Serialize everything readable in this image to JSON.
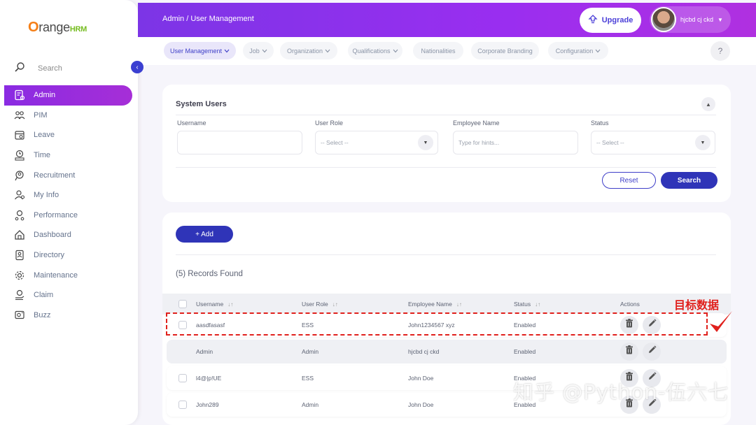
{
  "brand": {
    "logo_o": "O",
    "logo_text": "range",
    "logo_hrm": "HRM"
  },
  "sidebar": {
    "search_label": "Search",
    "items": [
      {
        "label": "Admin",
        "icon": "admin-icon",
        "active": true
      },
      {
        "label": "PIM",
        "icon": "pim-icon"
      },
      {
        "label": "Leave",
        "icon": "leave-icon"
      },
      {
        "label": "Time",
        "icon": "time-icon"
      },
      {
        "label": "Recruitment",
        "icon": "recruitment-icon"
      },
      {
        "label": "My Info",
        "icon": "my-info-icon"
      },
      {
        "label": "Performance",
        "icon": "performance-icon"
      },
      {
        "label": "Dashboard",
        "icon": "dashboard-icon"
      },
      {
        "label": "Directory",
        "icon": "directory-icon"
      },
      {
        "label": "Maintenance",
        "icon": "maintenance-icon"
      },
      {
        "label": "Claim",
        "icon": "claim-icon"
      },
      {
        "label": "Buzz",
        "icon": "buzz-icon"
      }
    ]
  },
  "header": {
    "breadcrumb": "Admin / User Management",
    "upgrade_label": "Upgrade",
    "user_name": "hjcbd cj ckd"
  },
  "tabs": [
    {
      "label": "User Management",
      "caret": true,
      "active": true
    },
    {
      "label": "Job",
      "caret": true
    },
    {
      "label": "Organization",
      "caret": true
    },
    {
      "label": "Qualifications",
      "caret": true
    },
    {
      "label": "Nationalities",
      "caret": false
    },
    {
      "label": "Corporate Branding",
      "caret": false
    },
    {
      "label": "Configuration",
      "caret": true
    }
  ],
  "help_label": "?",
  "filter": {
    "title": "System Users",
    "username_label": "Username",
    "username_value": "",
    "user_role_label": "User Role",
    "user_role_value": "-- Select --",
    "employee_name_label": "Employee Name",
    "employee_name_placeholder": "Type for hints...",
    "status_label": "Status",
    "status_value": "-- Select --",
    "reset_label": "Reset",
    "search_label": "Search"
  },
  "records": {
    "add_label": "+ Add",
    "count_text": "(5) Records Found",
    "columns": [
      "Username",
      "User Role",
      "Employee Name",
      "Status",
      "Actions"
    ],
    "rows": [
      {
        "username": "aasdfasasf",
        "role": "ESS",
        "employee": "John1234567 xyz",
        "status": "Enabled",
        "checkbox": true,
        "shaded": false
      },
      {
        "username": "Admin",
        "role": "Admin",
        "employee": "hjcbd cj ckd",
        "status": "Enabled",
        "checkbox": false,
        "shaded": true
      },
      {
        "username": "l4@|p!UE",
        "role": "ESS",
        "employee": "John Doe",
        "status": "Enabled",
        "checkbox": true,
        "shaded": false
      },
      {
        "username": "John289",
        "role": "Admin",
        "employee": "John Doe",
        "status": "Enabled",
        "checkbox": true,
        "shaded": false
      }
    ]
  },
  "annotation": {
    "target_label": "目标数据",
    "watermark": "知乎 @Python-伍六七",
    "color": "#e0201c"
  },
  "colors": {
    "accent": "#2f34b8",
    "header_start": "#7c35e6",
    "header_end": "#b030e0"
  }
}
